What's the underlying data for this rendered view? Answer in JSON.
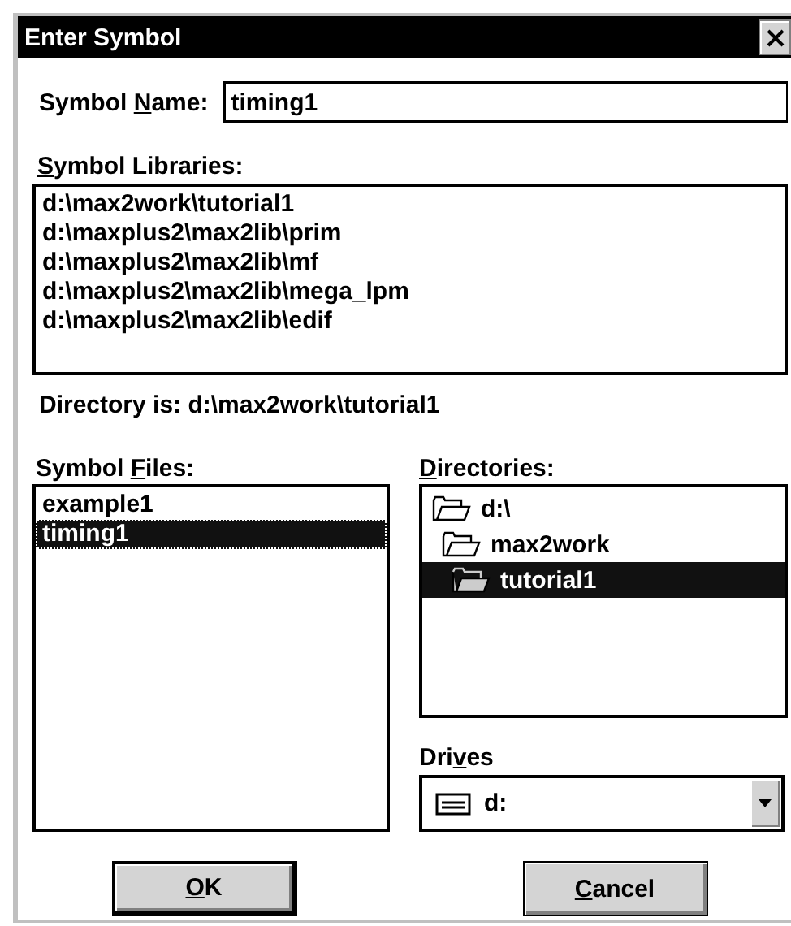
{
  "window": {
    "title": "Enter Symbol"
  },
  "symbol_name": {
    "label": {
      "before": "Symbol ",
      "key": "N",
      "after": "ame:"
    },
    "value": "timing1"
  },
  "symbol_libraries": {
    "label": {
      "key": "S",
      "after": "ymbol Libraries:"
    },
    "items": [
      {
        "text": "d:\\max2work\\tutorial1",
        "selected": false
      },
      {
        "text": "d:\\maxplus2\\max2lib\\prim",
        "selected": false
      },
      {
        "text": "d:\\maxplus2\\max2lib\\mf",
        "selected": false
      },
      {
        "text": "d:\\maxplus2\\max2lib\\mega_lpm",
        "selected": false
      },
      {
        "text": "d:\\maxplus2\\max2lib\\edif",
        "selected": false
      }
    ]
  },
  "directory_is": "Directory is:  d:\\max2work\\tutorial1",
  "symbol_files": {
    "label": {
      "before": "Symbol ",
      "key": "F",
      "after": "iles:"
    },
    "items": [
      {
        "text": "example1",
        "selected": false
      },
      {
        "text": "timing1",
        "selected": true
      }
    ]
  },
  "directories": {
    "label": {
      "key": "D",
      "after": "irectories:"
    },
    "items": [
      {
        "text": "d:\\",
        "selected": false,
        "children": [
          {
            "text": "max2work",
            "selected": false,
            "children": [
              {
                "text": "tutorial1",
                "selected": true
              }
            ]
          }
        ]
      }
    ]
  },
  "drives": {
    "label": {
      "before": "Dri",
      "key": "v",
      "after": "es"
    },
    "value": "d:"
  },
  "buttons": [
    {
      "label": {
        "key": "O",
        "after": "K"
      },
      "default": true
    },
    {
      "label": {
        "key": "C",
        "after": "ancel"
      },
      "default": false
    }
  ]
}
